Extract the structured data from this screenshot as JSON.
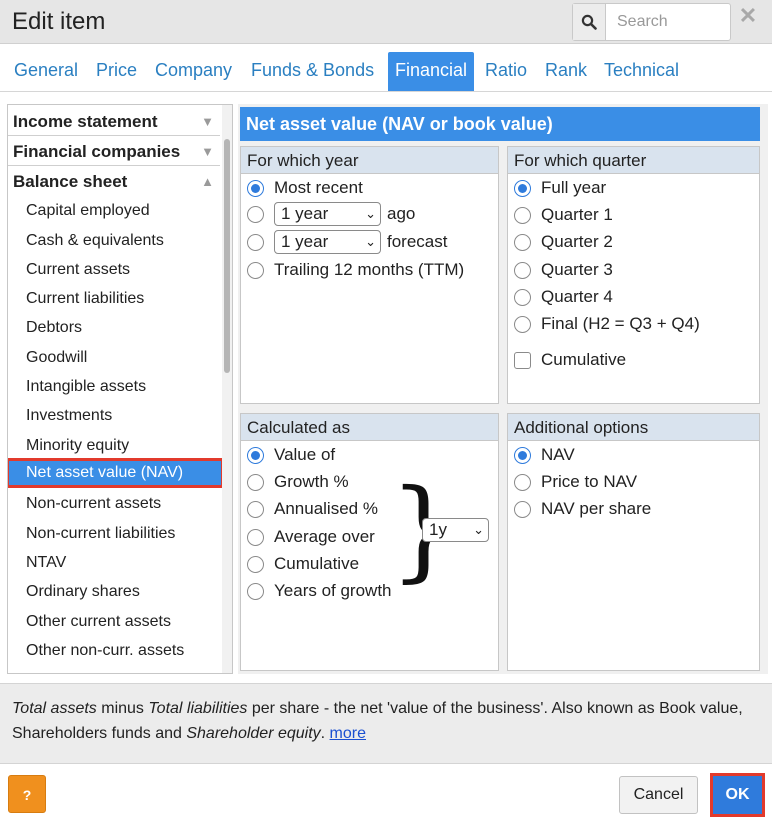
{
  "dialog": {
    "title": "Edit item"
  },
  "search": {
    "placeholder": "Search"
  },
  "tabs": [
    "General",
    "Price",
    "Company",
    "Funds & Bonds",
    "Financial",
    "Ratio",
    "Rank",
    "Technical"
  ],
  "active_tab": "Financial",
  "sidebar": {
    "categories": [
      "Income statement",
      "Financial companies",
      "Balance sheet"
    ],
    "items": [
      "Capital employed",
      "Cash & equivalents",
      "Current assets",
      "Current liabilities",
      "Debtors",
      "Goodwill",
      "Intangible assets",
      "Investments",
      "Minority equity",
      "Net asset value (NAV)",
      "Non-current assets",
      "Non-current liabilities",
      "NTAV",
      "Ordinary shares",
      "Other current assets",
      "Other non-curr. assets"
    ],
    "selected_item": "Net asset value (NAV)"
  },
  "main": {
    "section_title": "Net asset value (NAV or book value)",
    "year": {
      "title": "For which year",
      "most_recent": "Most recent",
      "ago_select": "1 year",
      "ago_label": "ago",
      "forecast_select": "1 year",
      "forecast_label": "forecast",
      "ttm": "Trailing 12 months (TTM)"
    },
    "quarter": {
      "title": "For which quarter",
      "options": [
        "Full year",
        "Quarter 1",
        "Quarter 2",
        "Quarter 3",
        "Quarter 4",
        "Final (H2 = Q3 + Q4)"
      ],
      "cumulative": "Cumulative"
    },
    "calculated": {
      "title": "Calculated as",
      "options": [
        "Value of",
        "Growth %",
        "Annualised %",
        "Average over",
        "Cumulative",
        "Years of growth"
      ],
      "period_select": "1y"
    },
    "additional": {
      "title": "Additional options",
      "options": [
        "NAV",
        "Price to NAV",
        "NAV per share"
      ]
    }
  },
  "description": {
    "part1": "Total assets",
    "part2": " minus ",
    "part3": "Total liabilities",
    "part4": " per share - the net 'value of the business'. Also known as Book value, Shareholders funds and ",
    "part5": "Shareholder equity",
    "part6": ". ",
    "more_link": "more"
  },
  "footer": {
    "help": "?",
    "cancel": "Cancel",
    "ok": "OK"
  },
  "colors": {
    "accent": "#3a8ee6",
    "highlight": "#e23a2c",
    "help": "#f0901e"
  }
}
